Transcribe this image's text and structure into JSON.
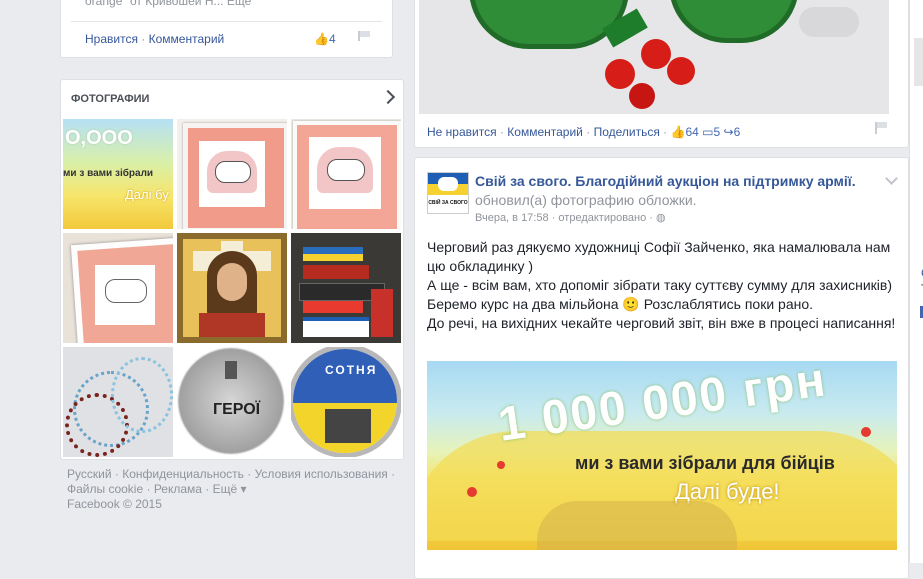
{
  "left": {
    "top_card": {
      "snippet": "orange\" от Кривошей Н... Еще",
      "actions": {
        "like": "Нравится",
        "comment": "Комментарий",
        "like_count": "4"
      }
    },
    "photos": {
      "title": "ФОТОГРАФИИ",
      "items": [
        "banner-1000000",
        "pink-heart-lamb-frame",
        "pink-heart-lamb-frame-2",
        "framed-lamb-embroidery",
        "jesus-icon-embroidery",
        "flags-stickers",
        "beaded-necklace",
        "coin-heroes",
        "coin-sotnia"
      ],
      "coin1_text": "ГЕРОЇ",
      "coin2_text": "СОТНЯ"
    },
    "footer": {
      "line1": [
        "Русский",
        "Конфиденциальность",
        "Условия использования"
      ],
      "line2": [
        "Файлы cookie",
        "Реклама",
        "Ещё"
      ],
      "copyright": "Facebook © 2015"
    }
  },
  "feed": {
    "prev_post": {
      "actions": {
        "unlike": "Не нравится",
        "comment": "Комментарий",
        "share": "Поделиться",
        "likes": "64",
        "comments": "5",
        "shares": "6"
      }
    },
    "post": {
      "page_name": "Свій за свого. Благодійний аукціон на підтримку армії.",
      "action": "обновил(а) фотографию обложки.",
      "time": "Вчера, в 17:58",
      "edited": "отредактировано",
      "logo_text": "СВІЙ ЗА СВОГО",
      "text": [
        "Черговий раз дякуємо художниці Софії Зайченко, яка намалювала нам цю обкладинку )",
        "А ще - всім вам, хто допоміг зібрати таку суттєву сумму для захисників)",
        "Беремо курс на два мільйона 🙂 Розслаблятись поки рано.",
        "До речі, на вихідних чекайте черговий звіт, він вже в процесі написання!"
      ],
      "image": {
        "headline": "1 000 000 грн",
        "line1": "ми з вами зібрали для бійців",
        "line2": "Далі буде!"
      }
    }
  },
  "right_edge": {
    "letters": [
      "С",
      "Т"
    ]
  },
  "colors": {
    "bg": "#e9ebee",
    "link": "#365899",
    "accent": "#4267b2"
  }
}
